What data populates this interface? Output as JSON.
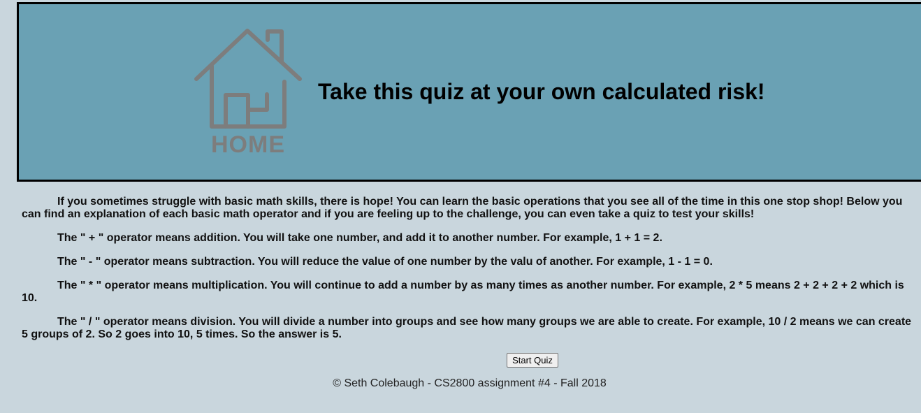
{
  "header": {
    "home_label": "HOME",
    "title": "Take this quiz at your own calculated risk!"
  },
  "content": {
    "paragraphs": [
      "If you sometimes struggle with basic math skills, there is hope! You can learn the basic operations that you see all of the time in this one stop shop! Below you can find an explanation of each basic math operator and if you are feeling up to the challenge, you can even take a quiz to test your skills!",
      "The \" + \" operator means addition. You will take one number, and add it to another number. For example, 1 + 1 = 2.",
      "The \" - \" operator means subtraction. You will reduce the value of one number by the valu of another. For example, 1 - 1 = 0.",
      "The \" * \" operator means multiplication. You will continue to add a number by as many times as another number. For example, 2 * 5 means 2 + 2 + 2 + 2 which is 10.",
      "The \" / \" operator means division. You will divide a number into groups and see how many groups we are able to create. For example, 10 / 2 means we can create 5 groups of 2. So 2 goes into 10, 5 times. So the answer is 5."
    ]
  },
  "quiz": {
    "start_label": "Start Quiz"
  },
  "footer": {
    "text": "© Seth Colebaugh - CS2800 assignment #4 - Fall 2018"
  },
  "colors": {
    "page_background": "#c9d6dd",
    "header_background": "#6aa1b4",
    "home_icon": "#7d7d7d"
  },
  "icons": {
    "home": "home-icon"
  }
}
